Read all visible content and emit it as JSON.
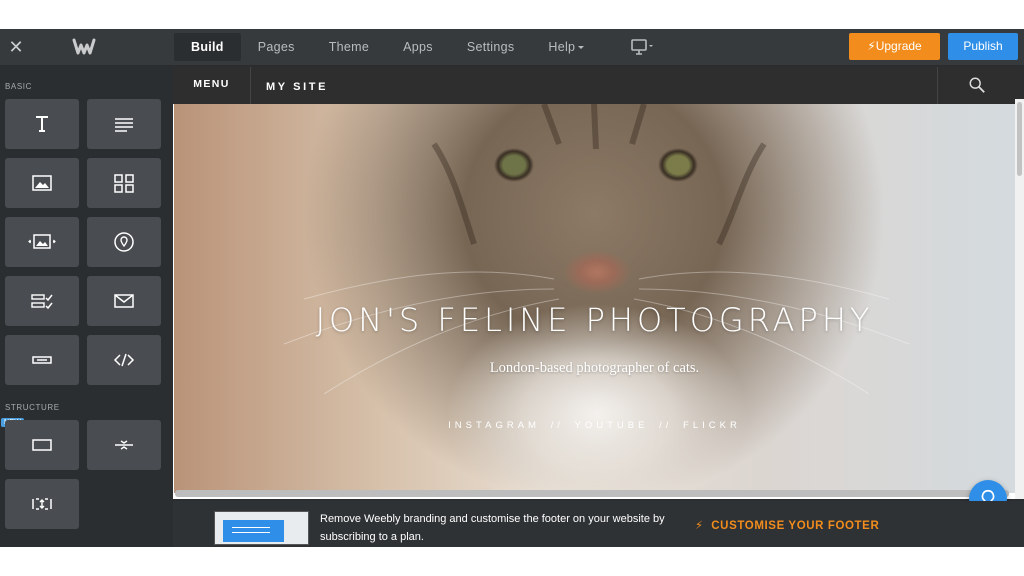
{
  "topbar": {
    "tabs": [
      {
        "label": "Build",
        "active": true
      },
      {
        "label": "Pages"
      },
      {
        "label": "Theme"
      },
      {
        "label": "Apps"
      },
      {
        "label": "Settings"
      },
      {
        "label": "Help"
      }
    ],
    "upgrade_label": "Upgrade",
    "publish_label": "Publish"
  },
  "sidebar": {
    "basic_label": "BASIC",
    "structure_label": "STRUCTURE",
    "new_badge": "NEW",
    "basic_tiles": [
      "title-icon",
      "text-icon",
      "image-icon",
      "gallery-icon",
      "slideshow-icon",
      "map-icon",
      "form-icon",
      "newsletter-icon",
      "button-icon",
      "embed-code-icon"
    ],
    "structure_tiles": [
      "section-icon",
      "divider-icon",
      "spacer-icon"
    ]
  },
  "site": {
    "menu_label": "MENU",
    "site_name": "MY SITE",
    "hero_title": "JON'S FELINE PHOTOGRAPHY",
    "hero_subtitle": "London-based photographer of cats.",
    "links": [
      "INSTAGRAM",
      "//",
      "YOUTUBE",
      "//",
      "FLICKR"
    ]
  },
  "footer": {
    "message": "Remove Weebly branding and customise the footer on your website by subscribing to a plan.",
    "cta": "CUSTOMISE YOUR FOOTER"
  },
  "colors": {
    "upgrade": "#f28c1c",
    "publish": "#2f8fe8",
    "toolbar": "#373a3d",
    "sidebar": "#2b2e31",
    "tile": "#494c50"
  }
}
